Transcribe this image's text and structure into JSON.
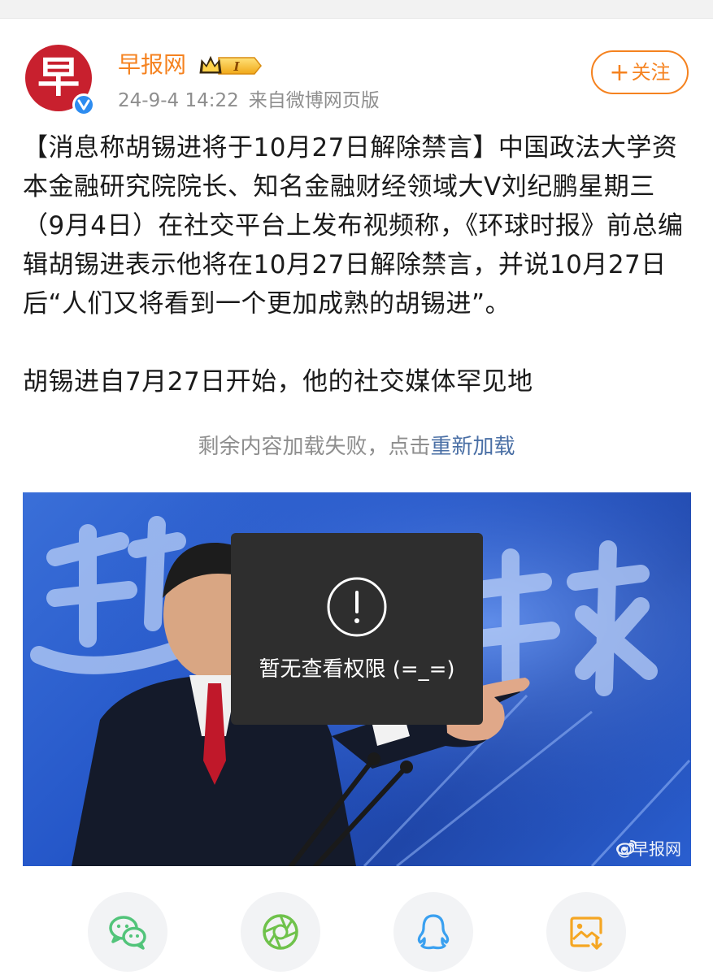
{
  "header": {
    "avatar_glyph": "早",
    "username": "早报网",
    "vip_level": "I",
    "timestamp": "24-9-4 14:22",
    "source": "来自微博网页版",
    "follow_label": "关注",
    "follow_plus": "+"
  },
  "post": {
    "paragraph_1": "【消息称胡锡进将于10月27日解除禁言】中国政法大学资本金融研究院院长、知名金融财经领域大V刘纪鹏星期三（9月4日）在社交平台上发布视频称，《环球时报》前总编辑胡锡进表示他将在10月27日解除禁言，并说10月27日后“人们又将看到一个更加成熟的胡锡进”。",
    "paragraph_2": "胡锡进自7月27日开始，他的社交媒体罕见地",
    "reload_prefix": "剩余内容加载失败，点击",
    "reload_link": "重新加载"
  },
  "image": {
    "watermark": "@早报网",
    "overlay_text": "暂无查看权限 (=_=)"
  },
  "share_bar": {
    "items": [
      {
        "icon": "wechat-icon",
        "color": "#52c47a"
      },
      {
        "icon": "moments-icon",
        "color": "#6fc24b"
      },
      {
        "icon": "qq-icon",
        "color": "#3aa0f0"
      },
      {
        "icon": "save-image-icon",
        "color": "#f5a623"
      }
    ]
  }
}
